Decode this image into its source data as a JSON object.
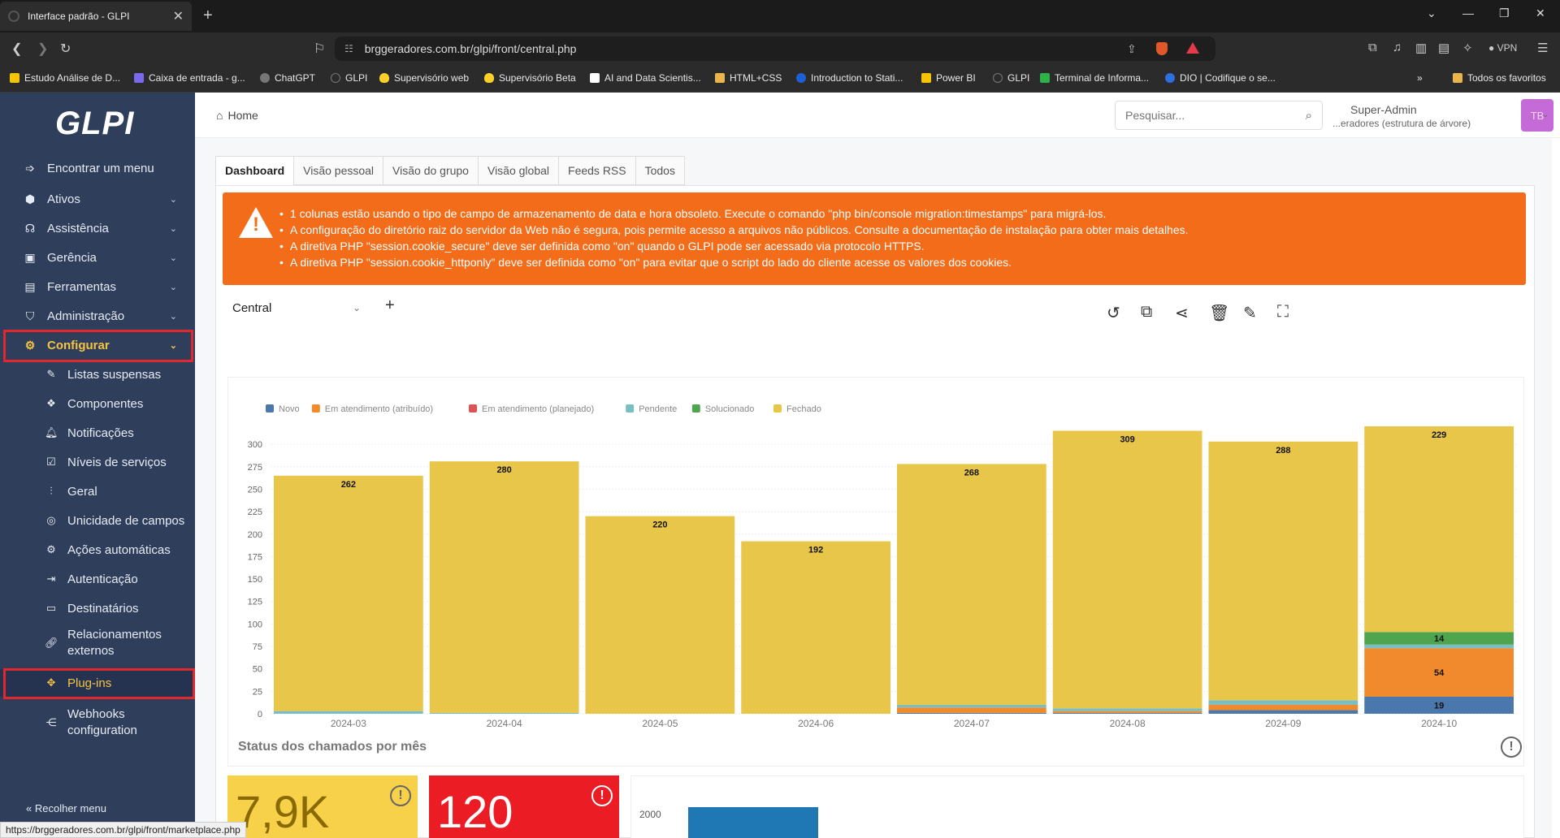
{
  "browser": {
    "tab_title": "Interface padrão - GLPI",
    "url": "brggeradores.com.br/glpi/front/central.php",
    "vpn_label": "VPN",
    "bookmarks": [
      "Estudo Análise de D...",
      "Caixa de entrada - g...",
      "ChatGPT",
      "GLPI",
      "Supervisório web",
      "Supervisório Beta",
      "AI and Data Scientis...",
      "HTML+CSS",
      "Introduction to Stati...",
      "Power BI",
      "GLPI",
      "Terminal de Informa...",
      "DIO | Codifique o se..."
    ],
    "bookmarks_more": "»",
    "favorites_folder": "Todos os favoritos",
    "status_url": "https://brggeradores.com.br/glpi/front/marketplace.php"
  },
  "sidebar": {
    "logo": "GLPI",
    "find_menu": "Encontrar um menu",
    "menu": [
      "Ativos",
      "Assistência",
      "Gerência",
      "Ferramentas",
      "Administração",
      "Configurar"
    ],
    "submenu": [
      "Listas suspensas",
      "Componentes",
      "Notificações",
      "Níveis de serviços",
      "Geral",
      "Unicidade de campos",
      "Ações automáticas",
      "Autenticação",
      "Destinatários",
      "Relacionamentos externos",
      "Plug-ins",
      "Webhooks configuration"
    ],
    "collapse": "Recolher menu"
  },
  "header": {
    "breadcrumb": "Home",
    "search_placeholder": "Pesquisar...",
    "user_name": "Super-Admin",
    "user_entity": "...eradores (estrutura de árvore)",
    "avatar_initials": "TB"
  },
  "tabs": [
    "Dashboard",
    "Visão pessoal",
    "Visão do grupo",
    "Visão global",
    "Feeds RSS",
    "Todos"
  ],
  "alerts": [
    "1 colunas estão usando o tipo de campo de armazenamento de data e hora obsoleto. Execute o comando \"php bin/console migration:timestamps\" para migrá-los.",
    "A configuração do diretório raiz do servidor da Web não é segura, pois permite acesso a arquivos não públicos. Consulte a documentação de instalação para obter mais detalhes.",
    "A diretiva PHP \"session.cookie_secure\" deve ser definida como \"on\" quando o GLPI pode ser acessado via protocolo HTTPS.",
    "A diretiva PHP \"session.cookie_httponly\" deve ser definida como \"on\" para evitar que o script do lado do cliente acesse os valores dos cookies."
  ],
  "dashboard_name": "Central",
  "mini_cards": [
    {
      "value": "7,9K",
      "color": "#f7d14a"
    },
    {
      "value": "120",
      "color": "#ec1c24"
    }
  ],
  "mini_chart_tick": "2000",
  "colors": {
    "sidebar_bg": "#2f3e5a",
    "accent_yellow": "#f6c343",
    "alert_orange": "#f36c1a",
    "highlight_red": "#e0282e"
  },
  "chart_data": {
    "type": "bar",
    "stacked": true,
    "title": "Status dos chamados por mês",
    "categories": [
      "2024-03",
      "2024-04",
      "2024-05",
      "2024-06",
      "2024-07",
      "2024-08",
      "2024-09",
      "2024-10"
    ],
    "ylim": [
      0,
      320
    ],
    "yticks": [
      0,
      25,
      50,
      75,
      100,
      125,
      150,
      175,
      200,
      225,
      250,
      275,
      300
    ],
    "legend_position": "top-left",
    "series": [
      {
        "name": "Novo",
        "color": "#4a78ac",
        "values": [
          0,
          0,
          0,
          0,
          1,
          1,
          4,
          19
        ]
      },
      {
        "name": "Em atendimento (atribuído)",
        "color": "#f08a2c",
        "values": [
          0,
          0,
          0,
          0,
          6,
          2,
          6,
          54
        ]
      },
      {
        "name": "Em atendimento (planejado)",
        "color": "#e05252",
        "values": [
          0,
          0,
          0,
          0,
          0,
          0,
          0,
          0
        ]
      },
      {
        "name": "Pendente",
        "color": "#78bec2",
        "values": [
          3,
          1,
          0,
          0,
          3,
          3,
          5,
          4
        ]
      },
      {
        "name": "Solucionado",
        "color": "#4fa54e",
        "values": [
          0,
          0,
          0,
          0,
          0,
          0,
          0,
          14
        ]
      },
      {
        "name": "Fechado",
        "color": "#e8c64a",
        "values": [
          262,
          280,
          220,
          192,
          268,
          309,
          288,
          229
        ]
      }
    ],
    "labels": [
      [
        null,
        null,
        null,
        null,
        null,
        "262"
      ],
      [
        null,
        null,
        null,
        null,
        null,
        "280"
      ],
      [
        null,
        null,
        null,
        null,
        null,
        "220"
      ],
      [
        null,
        null,
        null,
        null,
        null,
        "192"
      ],
      [
        null,
        null,
        null,
        null,
        null,
        "268"
      ],
      [
        null,
        null,
        null,
        null,
        null,
        "309"
      ],
      [
        null,
        null,
        null,
        null,
        null,
        "288"
      ],
      [
        "19",
        "54",
        null,
        null,
        "14",
        "229"
      ]
    ]
  }
}
